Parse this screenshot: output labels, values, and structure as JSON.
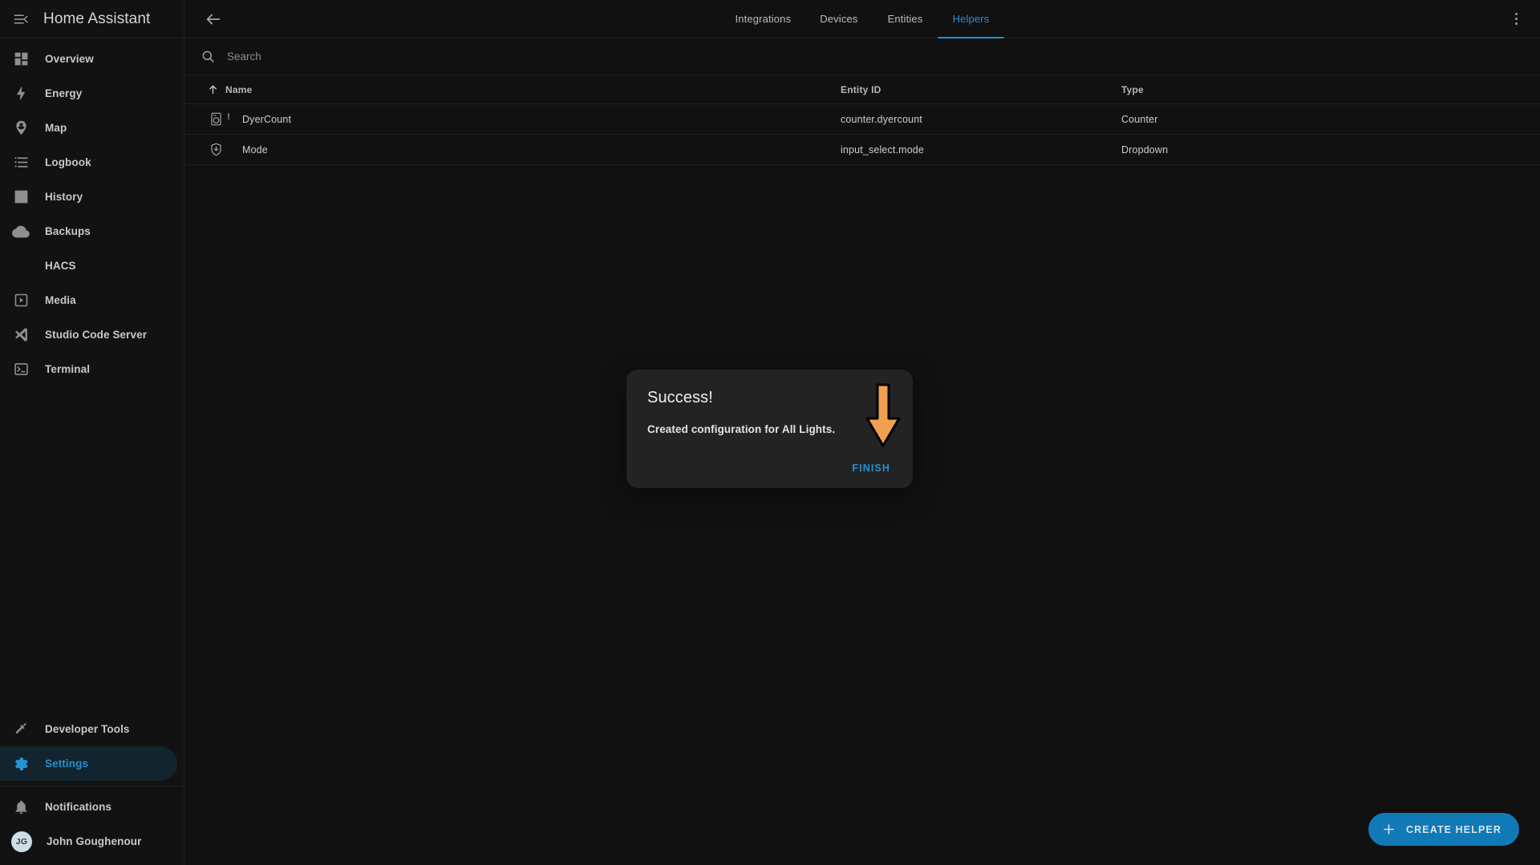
{
  "sidebar": {
    "title": "Home Assistant",
    "menu_icon": "menu-collapse-icon",
    "items": [
      {
        "label": "Overview",
        "icon": "view-dashboard-icon"
      },
      {
        "label": "Energy",
        "icon": "lightning-bolt-icon"
      },
      {
        "label": "Map",
        "icon": "map-marker-account-icon"
      },
      {
        "label": "Logbook",
        "icon": "format-list-bulleted-icon"
      },
      {
        "label": "History",
        "icon": "chart-box-icon"
      },
      {
        "label": "Backups",
        "icon": "cloud-upload-icon"
      },
      {
        "label": "HACS",
        "icon": "hacs-icon"
      },
      {
        "label": "Media",
        "icon": "play-box-icon"
      },
      {
        "label": "Studio Code Server",
        "icon": "vscode-icon"
      },
      {
        "label": "Terminal",
        "icon": "console-icon"
      }
    ],
    "bottom_items": [
      {
        "label": "Developer Tools",
        "icon": "hammer-icon",
        "active": false
      },
      {
        "label": "Settings",
        "icon": "cog-icon",
        "active": true
      }
    ],
    "footer_items": [
      {
        "label": "Notifications",
        "icon": "bell-icon"
      }
    ],
    "user": {
      "name": "John Goughenour",
      "initials": "JG"
    }
  },
  "header": {
    "back_icon": "arrow-left-icon",
    "overflow_icon": "dots-vertical-icon",
    "tabs": [
      {
        "label": "Integrations",
        "active": false
      },
      {
        "label": "Devices",
        "active": false
      },
      {
        "label": "Entities",
        "active": false
      },
      {
        "label": "Helpers",
        "active": true
      }
    ]
  },
  "search": {
    "placeholder": "Search",
    "value": "",
    "icon": "magnify-icon"
  },
  "table": {
    "columns": [
      {
        "key": "name",
        "label": "Name",
        "sorted": true,
        "sort_direction": "asc"
      },
      {
        "key": "entity_id",
        "label": "Entity ID"
      },
      {
        "key": "type",
        "label": "Type"
      }
    ],
    "rows": [
      {
        "icon": "washing-machine-icon",
        "badge": "!",
        "name": "DyerCount",
        "entity_id": "counter.dyercount",
        "type": "Counter"
      },
      {
        "icon": "shield-down-icon",
        "badge": "",
        "name": "Mode",
        "entity_id": "input_select.mode",
        "type": "Dropdown"
      }
    ]
  },
  "fab": {
    "label": "CREATE HELPER",
    "icon": "plus-icon",
    "color": "#1179b5"
  },
  "dialog": {
    "title": "Success!",
    "message": "Created configuration for All Lights.",
    "finish_label": "FINISH",
    "accent_color": "#2a8fd4"
  },
  "annotation": {
    "arrow": "down-arrow-annotation",
    "color": "#f0a050"
  }
}
